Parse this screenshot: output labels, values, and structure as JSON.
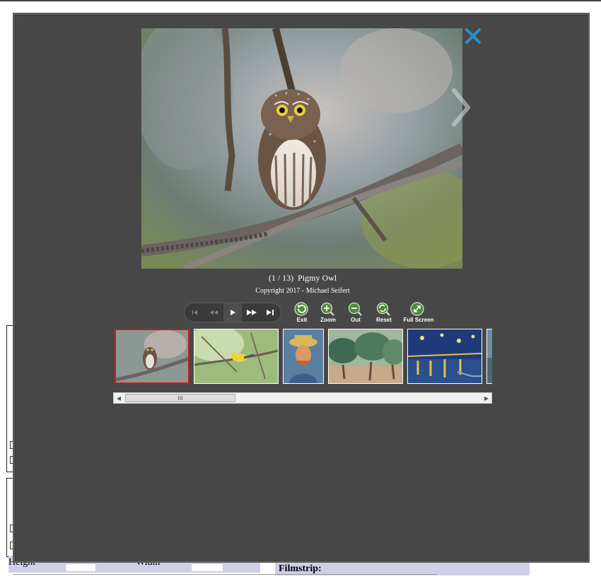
{
  "viewer": {
    "caption_index": "(1 / 13)",
    "caption_title": "Pigmy Owl",
    "copyright": "Copyright 2017 - Michael Seifert",
    "tools": [
      {
        "label": "Exit",
        "icon": "exit-icon"
      },
      {
        "label": "Zoom",
        "icon": "zoom-in-icon"
      },
      {
        "label": "Out",
        "icon": "zoom-out-icon"
      },
      {
        "label": "Reset",
        "icon": "reset-icon"
      },
      {
        "label": "Full Screen",
        "icon": "full-screen-icon"
      }
    ],
    "player_icons": [
      "first-icon",
      "rewind-icon",
      "play-icon",
      "fast-forward-icon",
      "last-icon"
    ],
    "scroll_grip": "III",
    "thumbnails": [
      "Pigmy Owl",
      "Warbler",
      "Van Gogh Self-Portrait",
      "Olive Trees",
      "Starry Night Over the Rhone",
      "Partial thumbnail"
    ]
  },
  "background_page": {
    "filmstrip_label": "Filmstrip:",
    "height_label": "Height",
    "width_label": "Width"
  },
  "colors": {
    "overlay": "#474747",
    "close_icon": "#2a8fd0",
    "active_thumb_border": "#d01818",
    "tool_icon": "#4e8a3a"
  }
}
